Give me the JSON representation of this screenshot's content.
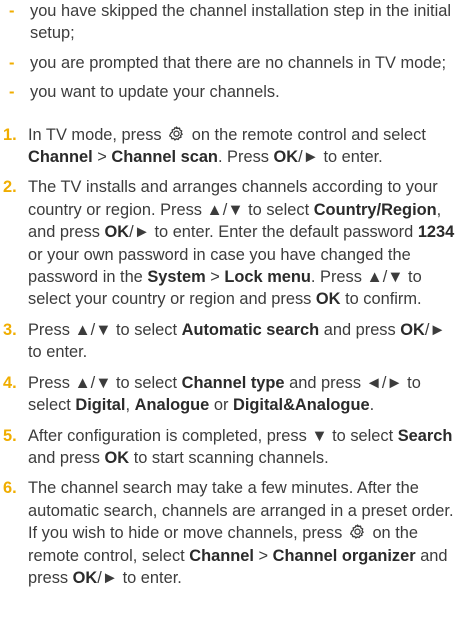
{
  "bullets": [
    "you have skipped the channel installation step in the initial setup;",
    "you are prompted that there are no channels in TV mode;",
    "you want to update your channels."
  ],
  "bullet_marker": "-",
  "steps": {
    "s1": {
      "num": "1.",
      "t1": "In TV mode, press",
      "t2": "on the remote control and select",
      "b1": "Channel",
      "t3": ">",
      "b2": "Channel scan",
      "t4": ". Press",
      "b3": "OK",
      "t5": "/► to enter."
    },
    "s2": {
      "num": "2.",
      "t1": "The TV installs and arranges channels according to your country or region. Press ▲/▼ to select",
      "b1": "Country/Region",
      "t2": ", and press",
      "b2": "OK",
      "t3": "/► to enter. Enter the default password",
      "b3": "1234",
      "t4": "or your own password in case you have changed the password in the",
      "b4": "System",
      "t5": ">",
      "b5": "Lock menu",
      "t6": ". Press ▲/▼ to select your country or region and press",
      "b6": "OK",
      "t7": "to confirm."
    },
    "s3": {
      "num": "3.",
      "t1": "Press ▲/▼ to select",
      "b1": "Automatic search",
      "t2": "and press",
      "b2": "OK",
      "t3": "/► to enter."
    },
    "s4": {
      "num": "4.",
      "t1": "Press ▲/▼ to select",
      "b1": "Channel type",
      "t2": "and press ◄/► to select",
      "b2": "Digital",
      "t3": ",",
      "b3": "Analogue",
      "t4": "or",
      "b4": "Digital&Analogue",
      "t5": "."
    },
    "s5": {
      "num": "5.",
      "t1": "After configuration is completed, press ▼ to select",
      "b1": "Search",
      "t2": "and press",
      "b2": "OK",
      "t3": "to start scanning channels."
    },
    "s6": {
      "num": "6.",
      "t1": "The channel search may take a few minutes. After the automatic search, channels are arranged in a preset order. If you wish to hide or move channels, press",
      "t2": "on the remote control, select",
      "b1": "Channel",
      "t3": ">",
      "b2": "Channel organizer",
      "t4": "and press",
      "b3": "OK",
      "t5": "/► to enter."
    }
  },
  "icons": {
    "settings": "gear-icon"
  },
  "colors": {
    "accent": "#f0ad00",
    "text": "#3c3c3c",
    "bold": "#2b2b2b"
  }
}
